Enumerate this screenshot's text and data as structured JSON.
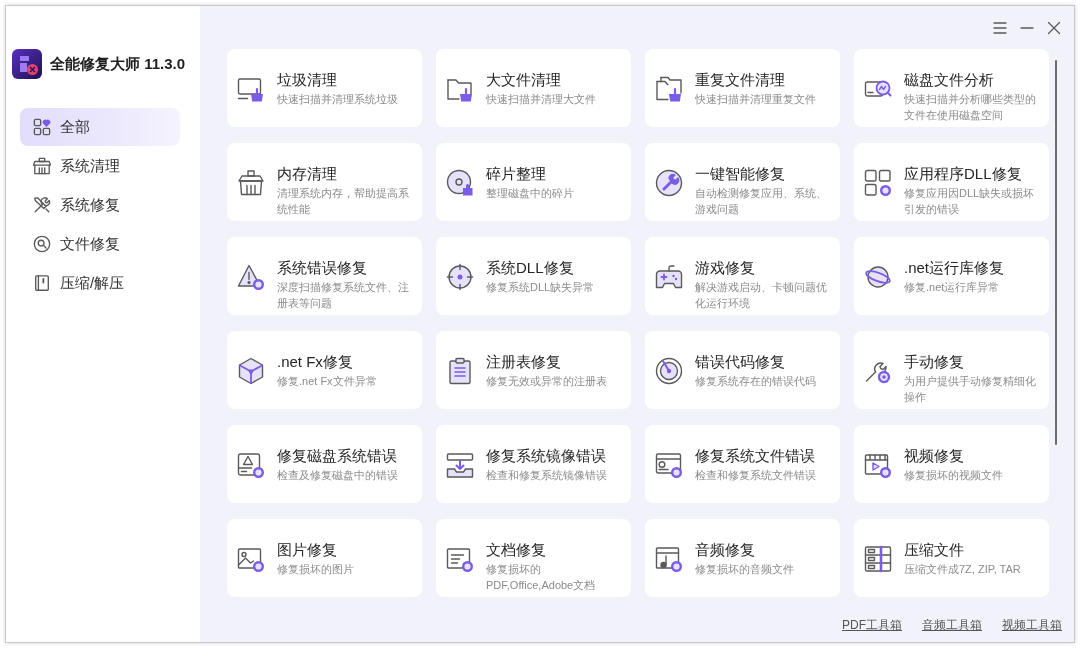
{
  "app": {
    "title": "全能修复大师 11.3.0"
  },
  "sidebar": {
    "items": [
      {
        "label": "全部",
        "selected": true
      },
      {
        "label": "系统清理",
        "selected": false
      },
      {
        "label": "系统修复",
        "selected": false
      },
      {
        "label": "文件修复",
        "selected": false
      },
      {
        "label": "压缩/解压",
        "selected": false
      }
    ]
  },
  "tools": [
    {
      "title": "垃圾清理",
      "description": "快速扫描并清理系统垃圾"
    },
    {
      "title": "大文件清理",
      "description": "快速扫描并清理大文件"
    },
    {
      "title": "重复文件清理",
      "description": "快速扫描并清理重复文件"
    },
    {
      "title": "磁盘文件分析",
      "description": "快速扫描并分析哪些类型的文件在使用磁盘空间"
    },
    {
      "title": "内存清理",
      "description": "清理系统内存，帮助提高系统性能"
    },
    {
      "title": "碎片整理",
      "description": "整理磁盘中的碎片"
    },
    {
      "title": "一键智能修复",
      "description": "自动检测修复应用、系统、游戏问题"
    },
    {
      "title": "应用程序DLL修复",
      "description": "修复应用因DLL缺失或损坏引发的错误"
    },
    {
      "title": "系统错误修复",
      "description": "深度扫描修复系统文件、注册表等问题"
    },
    {
      "title": "系统DLL修复",
      "description": "修复系统DLL缺失异常"
    },
    {
      "title": "游戏修复",
      "description": "解决游戏启动、卡顿问题优化运行环境"
    },
    {
      "title": ".net运行库修复",
      "description": "修复.net运行库异常"
    },
    {
      "title": ".net Fx修复",
      "description": "修复.net Fx文件异常"
    },
    {
      "title": "注册表修复",
      "description": "修复无效或异常的注册表"
    },
    {
      "title": "错误代码修复",
      "description": "修复系统存在的错误代码"
    },
    {
      "title": "手动修复",
      "description": "为用户提供手动修复精细化操作"
    },
    {
      "title": "修复磁盘系统错误",
      "description": "检查及修复磁盘中的错误"
    },
    {
      "title": "修复系统镜像错误",
      "description": "检查和修复系统镜像错误"
    },
    {
      "title": "修复系统文件错误",
      "description": "检查和修复系统文件错误"
    },
    {
      "title": "视频修复",
      "description": "修复损坏的视频文件"
    },
    {
      "title": "图片修复",
      "description": "修复损坏的图片"
    },
    {
      "title": "文档修复",
      "description": "修复损坏的PDF,Office,Adobe文档"
    },
    {
      "title": "音频修复",
      "description": "修复损坏的音频文件"
    },
    {
      "title": "压缩文件",
      "description": "压缩文件成7Z, ZIP, TAR"
    }
  ],
  "footer_links": [
    "PDF工具箱",
    "音频工具箱",
    "视频工具箱"
  ]
}
